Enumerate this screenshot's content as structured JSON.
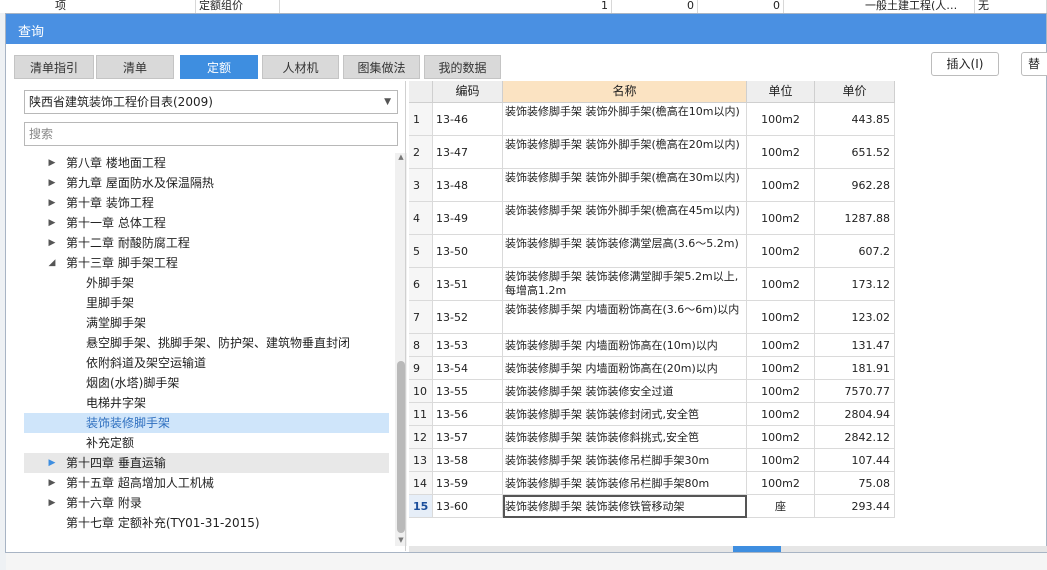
{
  "background": {
    "row_cells": [
      "项",
      "定额组价",
      "1",
      "0",
      "0",
      "一般土建工程(人…",
      "无"
    ]
  },
  "dialog": {
    "title": "查询",
    "tabs": [
      {
        "label": "清单指引",
        "active": false
      },
      {
        "label": "清单",
        "active": false
      },
      {
        "label": "定额",
        "active": true
      },
      {
        "label": "人材机",
        "active": false
      },
      {
        "label": "图集做法",
        "active": false
      },
      {
        "label": "我的数据",
        "active": false
      }
    ],
    "buttons": {
      "insert": "插入(I)",
      "replace": "替"
    }
  },
  "left_panel": {
    "catalog_select": "陕西省建筑装饰工程价目表(2009)",
    "search_placeholder": "搜索",
    "tree": [
      {
        "label": "第八章 楼地面工程",
        "level": 0,
        "caret": "right"
      },
      {
        "label": "第九章 屋面防水及保温隔热",
        "level": 0,
        "caret": "right"
      },
      {
        "label": "第十章 装饰工程",
        "level": 0,
        "caret": "right"
      },
      {
        "label": "第十一章 总体工程",
        "level": 0,
        "caret": "right"
      },
      {
        "label": "第十二章 耐酸防腐工程",
        "level": 0,
        "caret": "right"
      },
      {
        "label": "第十三章 脚手架工程",
        "level": 0,
        "caret": "down"
      },
      {
        "label": "外脚手架",
        "level": 1,
        "caret": ""
      },
      {
        "label": "里脚手架",
        "level": 1,
        "caret": ""
      },
      {
        "label": "满堂脚手架",
        "level": 1,
        "caret": ""
      },
      {
        "label": "悬空脚手架、挑脚手架、防护架、建筑物垂直封闭",
        "level": 1,
        "caret": ""
      },
      {
        "label": "依附斜道及架空运输道",
        "level": 1,
        "caret": ""
      },
      {
        "label": "烟囱(水塔)脚手架",
        "level": 1,
        "caret": ""
      },
      {
        "label": "电梯井字架",
        "level": 1,
        "caret": ""
      },
      {
        "label": "装饰装修脚手架",
        "level": 1,
        "caret": "",
        "selected": true
      },
      {
        "label": "补充定额",
        "level": 1,
        "caret": ""
      },
      {
        "label": "第十四章 垂直运输",
        "level": 0,
        "caret": "right",
        "hover": true
      },
      {
        "label": "第十五章 超高增加人工机械",
        "level": 0,
        "caret": "right"
      },
      {
        "label": "第十六章 附录",
        "level": 0,
        "caret": "right"
      },
      {
        "label": "第十七章 定额补充(TY01-31-2015)",
        "level": 0,
        "caret": ""
      }
    ]
  },
  "grid": {
    "columns": [
      "",
      "编码",
      "名称",
      "单位",
      "单价"
    ],
    "rows": [
      {
        "n": "1",
        "code": "13-46",
        "name": "装饰装修脚手架 装饰外脚手架(檐高在10m以内)",
        "unit": "100m2",
        "price": "443.85"
      },
      {
        "n": "2",
        "code": "13-47",
        "name": "装饰装修脚手架 装饰外脚手架(檐高在20m以内)",
        "unit": "100m2",
        "price": "651.52"
      },
      {
        "n": "3",
        "code": "13-48",
        "name": "装饰装修脚手架 装饰外脚手架(檐高在30m以内)",
        "unit": "100m2",
        "price": "962.28"
      },
      {
        "n": "4",
        "code": "13-49",
        "name": "装饰装修脚手架 装饰外脚手架(檐高在45m以内)",
        "unit": "100m2",
        "price": "1287.88"
      },
      {
        "n": "5",
        "code": "13-50",
        "name": "装饰装修脚手架 装饰装修满堂层高(3.6～5.2m)",
        "unit": "100m2",
        "price": "607.2"
      },
      {
        "n": "6",
        "code": "13-51",
        "name": "装饰装修脚手架 装饰装修满堂脚手架5.2m以上,每增高1.2m",
        "unit": "100m2",
        "price": "173.12"
      },
      {
        "n": "7",
        "code": "13-52",
        "name": "装饰装修脚手架 内墙面粉饰高在(3.6～6m)以内",
        "unit": "100m2",
        "price": "123.02"
      },
      {
        "n": "8",
        "code": "13-53",
        "name": "装饰装修脚手架 内墙面粉饰高在(10m)以内",
        "unit": "100m2",
        "price": "131.47"
      },
      {
        "n": "9",
        "code": "13-54",
        "name": "装饰装修脚手架 内墙面粉饰高在(20m)以内",
        "unit": "100m2",
        "price": "181.91"
      },
      {
        "n": "10",
        "code": "13-55",
        "name": "装饰装修脚手架 装饰装修安全过道",
        "unit": "100m2",
        "price": "7570.77"
      },
      {
        "n": "11",
        "code": "13-56",
        "name": "装饰装修脚手架 装饰装修封闭式,安全笆",
        "unit": "100m2",
        "price": "2804.94"
      },
      {
        "n": "12",
        "code": "13-57",
        "name": "装饰装修脚手架 装饰装修斜挑式,安全笆",
        "unit": "100m2",
        "price": "2842.12"
      },
      {
        "n": "13",
        "code": "13-58",
        "name": "装饰装修脚手架 装饰装修吊栏脚手架30m",
        "unit": "100m2",
        "price": "107.44"
      },
      {
        "n": "14",
        "code": "13-59",
        "name": "装饰装修脚手架 装饰装修吊栏脚手架80m",
        "unit": "100m2",
        "price": "75.08"
      },
      {
        "n": "15",
        "code": "13-60",
        "name": "装饰装修脚手架 装饰装修铁管移动架",
        "unit": "座",
        "price": "293.44",
        "current": true
      }
    ]
  }
}
